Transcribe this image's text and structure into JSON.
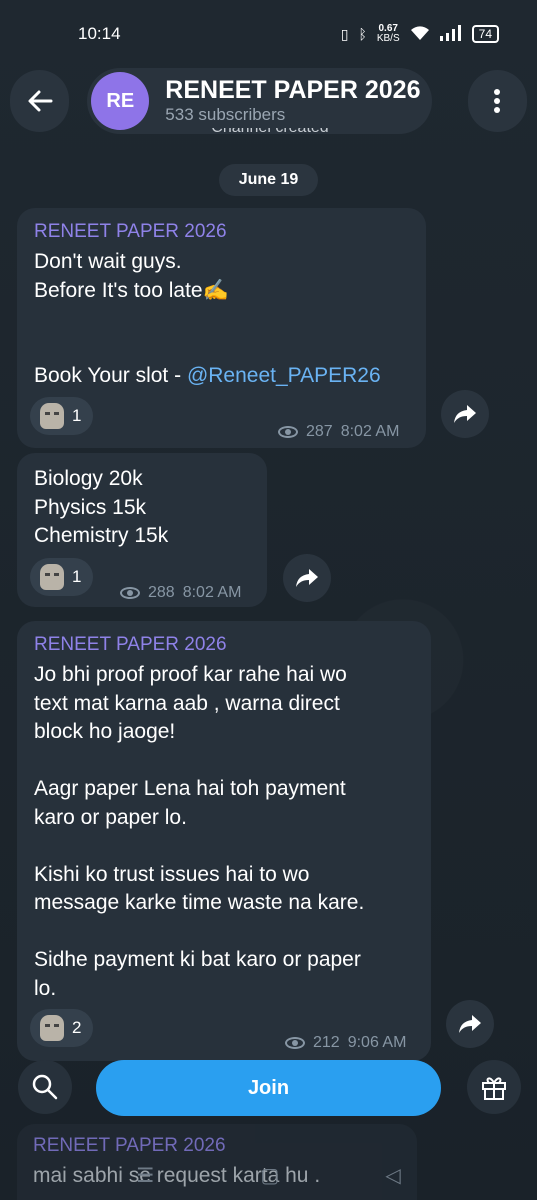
{
  "status_bar": {
    "time": "10:14",
    "net_speed": "0.67",
    "net_unit": "KB/S",
    "battery": "74"
  },
  "header": {
    "avatar_initials": "RE",
    "channel_name": "RENEET PAPER 2026",
    "subscribers": "533 subscribers"
  },
  "service_message": "Channel created",
  "date_label": "June 19",
  "messages": [
    {
      "sender": "RENEET PAPER 2026",
      "text_main": "Don't wait guys.\nBefore It's too late✍️\n\n\nBook Your slot - ",
      "link": "@Reneet_PAPER26",
      "reaction_count": "1",
      "views": "287",
      "time": "8:02 AM"
    },
    {
      "text_main": "Biology 20k\nPhysics 15k\nChemistry 15k",
      "reaction_count": "1",
      "views": "288",
      "time": "8:02 AM"
    },
    {
      "sender": "RENEET PAPER 2026",
      "text_main": "Jo bhi proof proof kar rahe hai wo\ntext mat karna aab , warna direct\nblock ho jaoge!\n\nAagr paper Lena hai toh payment\nkaro or paper lo.\n\nKishi ko trust issues hai to wo\nmessage karke time waste na kare.\n\nSidhe payment ki bat karo or paper\nlo.",
      "reaction_count": "2",
      "views": "212",
      "time": "9:06 AM"
    },
    {
      "sender": "RENEET PAPER 2026",
      "text_main": "mai sabhi se request karta hu ."
    }
  ],
  "bottom": {
    "join_label": "Join"
  },
  "icons": {
    "back": "arrow-left-icon",
    "menu": "more-vertical-icon",
    "share": "share-arrow-icon",
    "search": "search-icon",
    "gift": "gift-icon",
    "views": "eye-icon"
  }
}
